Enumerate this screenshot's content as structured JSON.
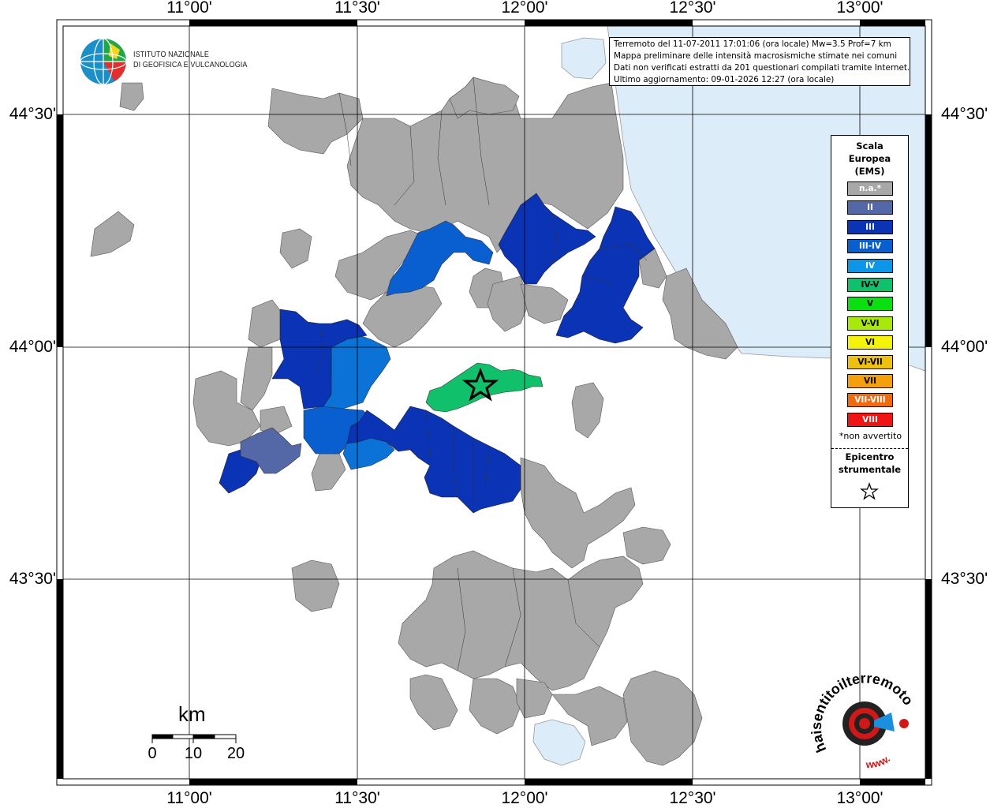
{
  "map": {
    "lon_labels": [
      "11°00'",
      "11°30'",
      "12°00'",
      "12°30'",
      "13°00'"
    ],
    "lat_labels": [
      "44°30'",
      "44°00'",
      "43°30'"
    ],
    "epicenter_label": "Epicentro strumentale"
  },
  "header": {
    "line1": "Terremoto del 11-07-2011 17:01:06 (ora locale) Mw=3.5 Prof=7 km",
    "line2": "Mappa preliminare delle intensità macrosismiche stimate nei comuni",
    "line3": "Dati non verificati estratti da 201 questionari compilati tramite Internet.",
    "line4": "Ultimo aggiornamento: 09-01-2026 12:27 (ora locale)"
  },
  "logo": {
    "line1": "ISTITUTO NAZIONALE",
    "line2": "DI GEOFISICA E VULCANOLOGIA"
  },
  "legend": {
    "title1": "Scala",
    "title2": "Europea",
    "title3": "(EMS)",
    "items": [
      {
        "label": "n.a.*",
        "color": "#a8a8a8"
      },
      {
        "label": "II",
        "color": "#5468a8"
      },
      {
        "label": "III",
        "color": "#0a33b5"
      },
      {
        "label": "III-IV",
        "color": "#0a5fd0"
      },
      {
        "label": "IV",
        "color": "#0b96e8"
      },
      {
        "label": "IV-V",
        "color": "#11c06a"
      },
      {
        "label": "V",
        "color": "#0ae010"
      },
      {
        "label": "V-VI",
        "color": "#a8e80a"
      },
      {
        "label": "VI",
        "color": "#f4f40a"
      },
      {
        "label": "VI-VII",
        "color": "#f0c010"
      },
      {
        "label": "VII",
        "color": "#f4a00a"
      },
      {
        "label": "VII-VIII",
        "color": "#f06a10"
      },
      {
        "label": "VIII",
        "color": "#f01414"
      }
    ],
    "note": "*non avvertito",
    "epicenter_title1": "Epicentro",
    "epicenter_title2": "strumentale"
  },
  "scalebar": {
    "unit": "km",
    "ticks": [
      "0",
      "10",
      "20"
    ]
  },
  "brand": {
    "text": "haisentitoilterremoto.it",
    "www": "www."
  },
  "colors": {
    "sea": "#dcecf8",
    "na": "#a8a8a8",
    "ii": "#5468a8",
    "iii": "#0a33b5",
    "iii_iv": "#0a5fd0",
    "iv_v": "#11c06a"
  }
}
